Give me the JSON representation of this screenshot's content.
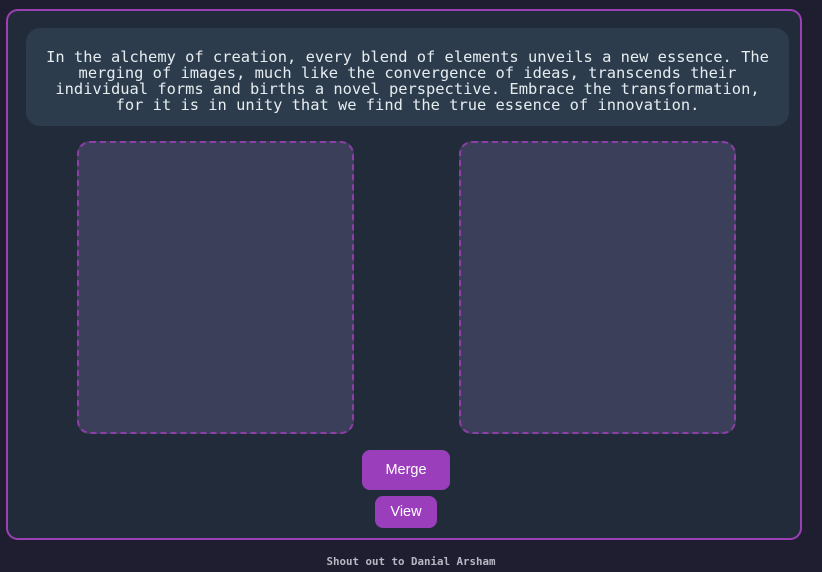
{
  "quote": {
    "text": "In the alchemy of creation, every blend of elements unveils a new essence. The merging of images, much like the convergence of ideas, transcends their individual forms and births a novel perspective. Embrace the transformation, for it is in unity that we find the true essence of innovation."
  },
  "image_slots": {
    "left": "",
    "right": ""
  },
  "actions": {
    "merge_label": "Merge",
    "view_label": "View"
  },
  "footer": {
    "text": "Shout out to Danial Arsham"
  },
  "colors": {
    "page_background": "#1f1e30",
    "panel_background": "#222b3a",
    "quote_background": "#2d3c4c",
    "accent": "#9a3ebc",
    "slot_background": "#3b3f59"
  }
}
